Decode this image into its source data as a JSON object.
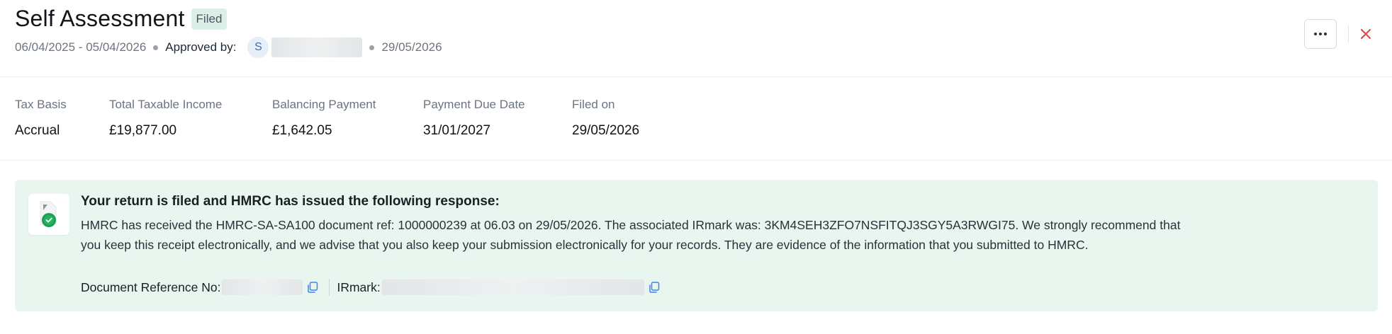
{
  "header": {
    "title": "Self Assessment",
    "status_badge": "Filed",
    "period": "06/04/2025 - 05/04/2026",
    "approved_by_label": "Approved by:",
    "approver_initial": "S",
    "approved_date": "29/05/2026"
  },
  "summary": {
    "fields": [
      {
        "label": "Tax Basis",
        "value": "Accrual"
      },
      {
        "label": "Total Taxable Income",
        "value": "£19,877.00"
      },
      {
        "label": "Balancing Payment",
        "value": "£1,642.05"
      },
      {
        "label": "Payment Due Date",
        "value": "31/01/2027"
      },
      {
        "label": "Filed on",
        "value": "29/05/2026"
      }
    ]
  },
  "response": {
    "title": "Your return is filed and HMRC has issued the following response:",
    "body": "HMRC has received the HMRC-SA-SA100 document ref: 1000000239 at 06.03 on 29/05/2026. The associated IRmark was: 3KM4SEH3ZFO7NSFITQJ3SGY5A3RWGI75. We strongly recommend that you keep this receipt electronically, and we advise that you also keep your submission electronically for your records. They are evidence of the information that you submitted to HMRC.",
    "doc_ref_label": "Document Reference No:",
    "irmark_label": "IRmark:"
  },
  "colors": {
    "panel_bg": "#e9f6f0",
    "badge_bg": "#dcefe7",
    "close_red": "#e5484d",
    "copy_blue": "#3b82f6",
    "success_green": "#22a35a"
  },
  "icons": {
    "more": "more-horizontal-icon",
    "close": "close-icon",
    "document_success": "document-check-icon",
    "copy": "copy-icon"
  }
}
